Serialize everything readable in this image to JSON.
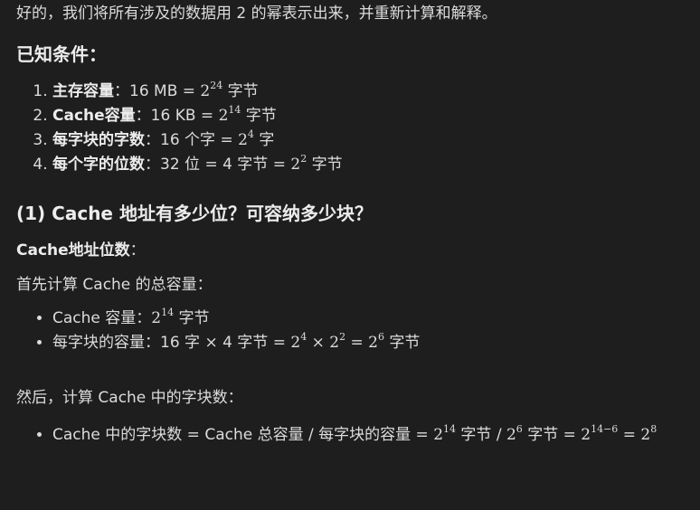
{
  "intro": "好的，我们将所有涉及的数据用 2 的幂表示出来，并重新计算和解释。",
  "known_heading": "已知条件：",
  "known": [
    {
      "label": "主存容量",
      "sep": "：",
      "text": "16 MB = ",
      "base": "2",
      "exp": "24",
      "unit": " 字节"
    },
    {
      "label": "Cache容量",
      "sep": "：",
      "text": "16 KB = ",
      "base": "2",
      "exp": "14",
      "unit": " 字节"
    },
    {
      "label": "每字块的字数",
      "sep": "：",
      "text": "16 个字 = ",
      "base": "2",
      "exp": "4",
      "unit": " 字"
    },
    {
      "label": "每个字的位数",
      "sep": "：",
      "text": "32 位 = 4 字节 = ",
      "base": "2",
      "exp": "2",
      "unit": " 字节"
    }
  ],
  "section1_heading": "(1) Cache 地址有多少位？可容纳多少块？",
  "addr_label": "Cache地址位数",
  "addr_label_sep": "：",
  "p1": "首先计算 Cache 的总容量：",
  "bullets1": {
    "b1_text": "Cache 容量：",
    "b1_base": "2",
    "b1_exp": "14",
    "b1_unit": " 字节",
    "b2_text": "每字块的容量：16 字 × 4 字节 = ",
    "b2_m1b": "2",
    "b2_m1e": "4",
    "b2_times": " × ",
    "b2_m2b": "2",
    "b2_m2e": "2",
    "b2_eq": " = ",
    "b2_m3b": "2",
    "b2_m3e": "6",
    "b2_unit": " 字节"
  },
  "p2": "然后，计算 Cache 中的字块数：",
  "bullet2": {
    "t1": "Cache 中的字块数 = Cache 总容量 / 每字块的容量 = ",
    "m1b": "2",
    "m1e": "14",
    "t2": " 字节 / ",
    "m2b": "2",
    "m2e": "6",
    "t3": " 字节 = ",
    "m3b": "2",
    "m3e": "14−6",
    "eq": " = ",
    "m4b": "2",
    "m4e": "8"
  }
}
